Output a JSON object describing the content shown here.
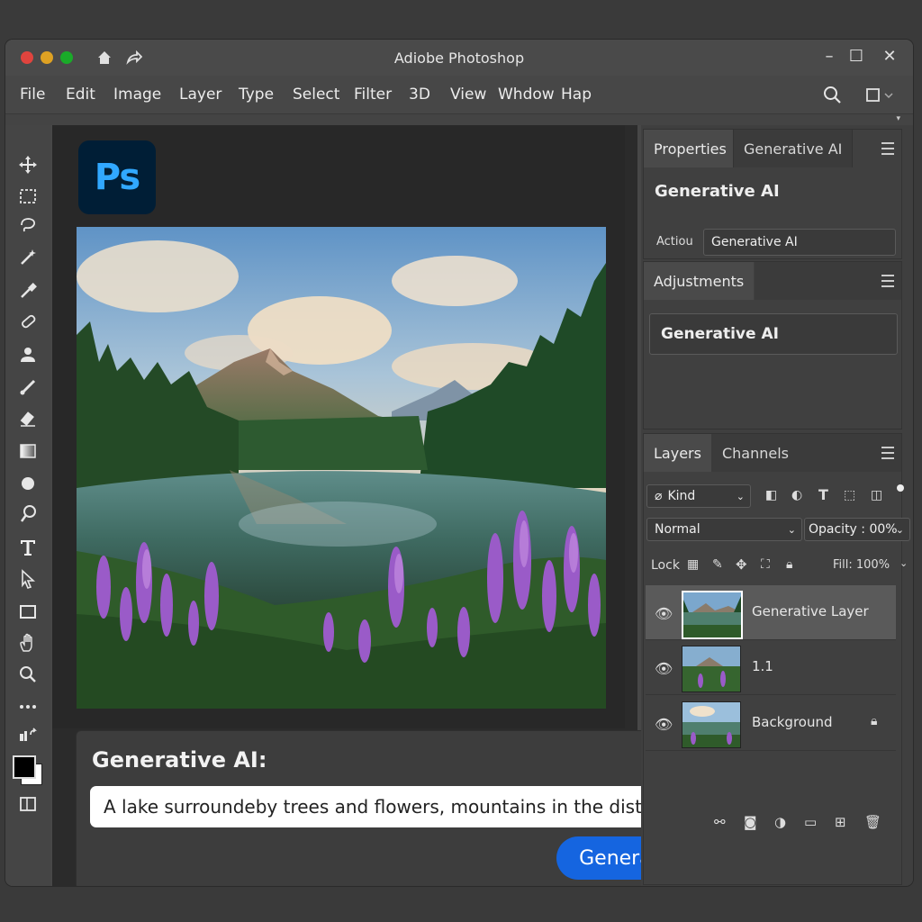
{
  "app": {
    "title": "Adiobe Photoshop",
    "logo_text": "Ps"
  },
  "menu": [
    "File",
    "Edit",
    "Image",
    "Layer",
    "Type",
    "Select",
    "Filter",
    "3D",
    "View",
    "Whdow",
    "Hap"
  ],
  "properties_panel": {
    "tabs": [
      "Properties",
      "Generative AI"
    ],
    "heading": "Generative AI",
    "action_label": "Actiou",
    "action_value": "Generative AI"
  },
  "adjustments_panel": {
    "tab": "Adjustments",
    "value": "Generative AI"
  },
  "layers_panel": {
    "tabs": [
      "Layers",
      "Channels"
    ],
    "kind_label": "Kind",
    "blend_mode": "Normal",
    "opacity_label": "Opacity : 00%",
    "lock_label": "Lock",
    "fill_label": "Fill: 100%",
    "layers": [
      {
        "name": "Generative Layer",
        "selected": true
      },
      {
        "name": "1.1",
        "selected": false
      },
      {
        "name": "Background",
        "selected": false,
        "locked": true
      }
    ]
  },
  "generative_prompt": {
    "title": "Generative AI:",
    "prompt_value": "A lake surroundeby trees and flowers, mountains in the distance",
    "button_label": "Generate"
  },
  "colors": {
    "accent_blue": "#1565e0",
    "ps_logo_bg": "#001e36",
    "ps_logo_text": "#31a8ff"
  },
  "icons": {
    "window_controls": [
      "minimize-icon",
      "maximize-icon",
      "close-icon"
    ],
    "toolbar": [
      "move-icon",
      "marquee-icon",
      "lasso-icon",
      "magic-wand-icon",
      "eyedropper-icon",
      "healing-icon",
      "stamp-icon",
      "brush-icon",
      "eraser-icon",
      "gradient-icon",
      "blur-icon",
      "dodge-icon",
      "type-icon",
      "path-select-icon",
      "shape-icon",
      "hand-icon",
      "zoom-icon",
      "more-icon"
    ]
  }
}
